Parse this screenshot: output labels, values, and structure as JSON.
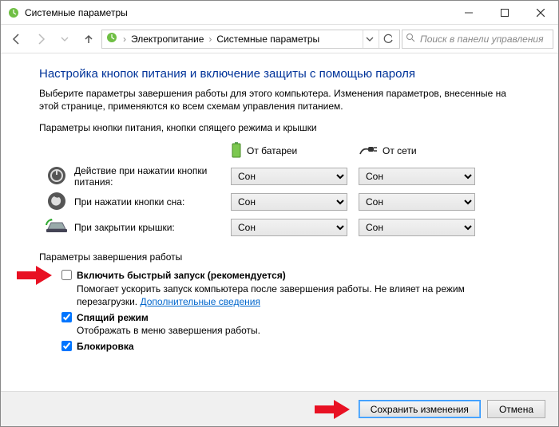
{
  "window": {
    "title": "Системные параметры"
  },
  "breadcrumb": {
    "items": [
      "Электропитание",
      "Системные параметры"
    ]
  },
  "search": {
    "placeholder": "Поиск в панели управления"
  },
  "page": {
    "heading": "Настройка кнопок питания и включение защиты с помощью пароля",
    "description": "Выберите параметры завершения работы для этого компьютера. Изменения параметров, внесенные на этой странице, применяются ко всем схемам управления питанием.",
    "power_section_label": "Параметры кнопки питания, кнопки спящего режима и крышки",
    "battery_label": "От батареи",
    "ac_label": "От сети",
    "rows": [
      {
        "label": "Действие при нажатии кнопки питания:",
        "battery": "Сон",
        "ac": "Сон"
      },
      {
        "label": "При нажатии кнопки сна:",
        "battery": "Сон",
        "ac": "Сон"
      },
      {
        "label": "При закрытии крышки:",
        "battery": "Сон",
        "ac": "Сон"
      }
    ],
    "shutdown_section_label": "Параметры завершения работы",
    "fast_startup": {
      "checked": false,
      "label": "Включить быстрый запуск (рекомендуется)",
      "sub": "Помогает ускорить запуск компьютера после завершения работы. Не влияет на режим перезагрузки. ",
      "link": "Дополнительные сведения"
    },
    "sleep": {
      "checked": true,
      "label": "Спящий режим",
      "sub": "Отображать в меню завершения работы."
    },
    "lock": {
      "checked": true,
      "label": "Блокировка"
    }
  },
  "footer": {
    "save": "Сохранить изменения",
    "cancel": "Отмена"
  }
}
